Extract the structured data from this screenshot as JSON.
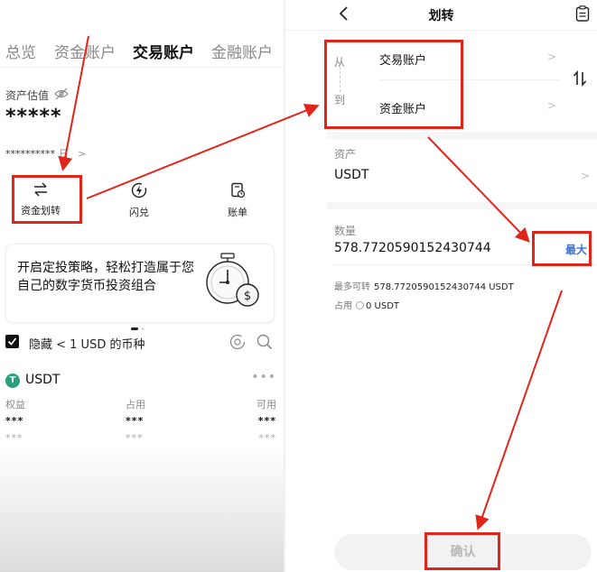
{
  "left": {
    "tabs": [
      "总览",
      "资金账户",
      "交易账户",
      "金融账户"
    ],
    "active_tab": "交易账户",
    "asset_label": "资产估值",
    "asset_value": "*****",
    "asset_sub_masked": "**********",
    "asset_sub_date": "日",
    "asset_sub_chevron": ">",
    "actions": [
      {
        "label": "资金划转",
        "icon": "transfer-icon"
      },
      {
        "label": "闪兑",
        "icon": "flash-swap-icon"
      },
      {
        "label": "账单",
        "icon": "bill-icon"
      }
    ],
    "promo_text": "开启定投策略，轻松打造属于您自己的数字货币投资组合",
    "hide_small_label": "隐藏 < 1 USD 的币种",
    "coin": {
      "name": "USDT",
      "logo_letter": "T",
      "more": "•••",
      "columns": [
        {
          "header": "权益",
          "value": "***",
          "sub": "***"
        },
        {
          "header": "占用",
          "value": "***",
          "sub": "***"
        },
        {
          "header": "可用",
          "value": "***",
          "sub": "***"
        }
      ]
    }
  },
  "right": {
    "title": "划转",
    "from_label": "从",
    "to_label": "到",
    "from_account": "交易账户",
    "to_account": "资金账户",
    "row_chevron": ">",
    "asset_section_label": "资产",
    "asset_value": "USDT",
    "quantity_label": "数量",
    "quantity_value": "578.7720590152430744",
    "max_label": "最大",
    "max_transferable_label": "最多可转",
    "max_transferable_value": "578.7720590152430744 USDT",
    "occupied_label": "占用",
    "occupied_value": "0 USDT",
    "confirm_label": "确认"
  },
  "colors": {
    "annotation_red": "#e1251b",
    "max_blue": "#3b73d6",
    "usdt_green": "#26a17b"
  }
}
